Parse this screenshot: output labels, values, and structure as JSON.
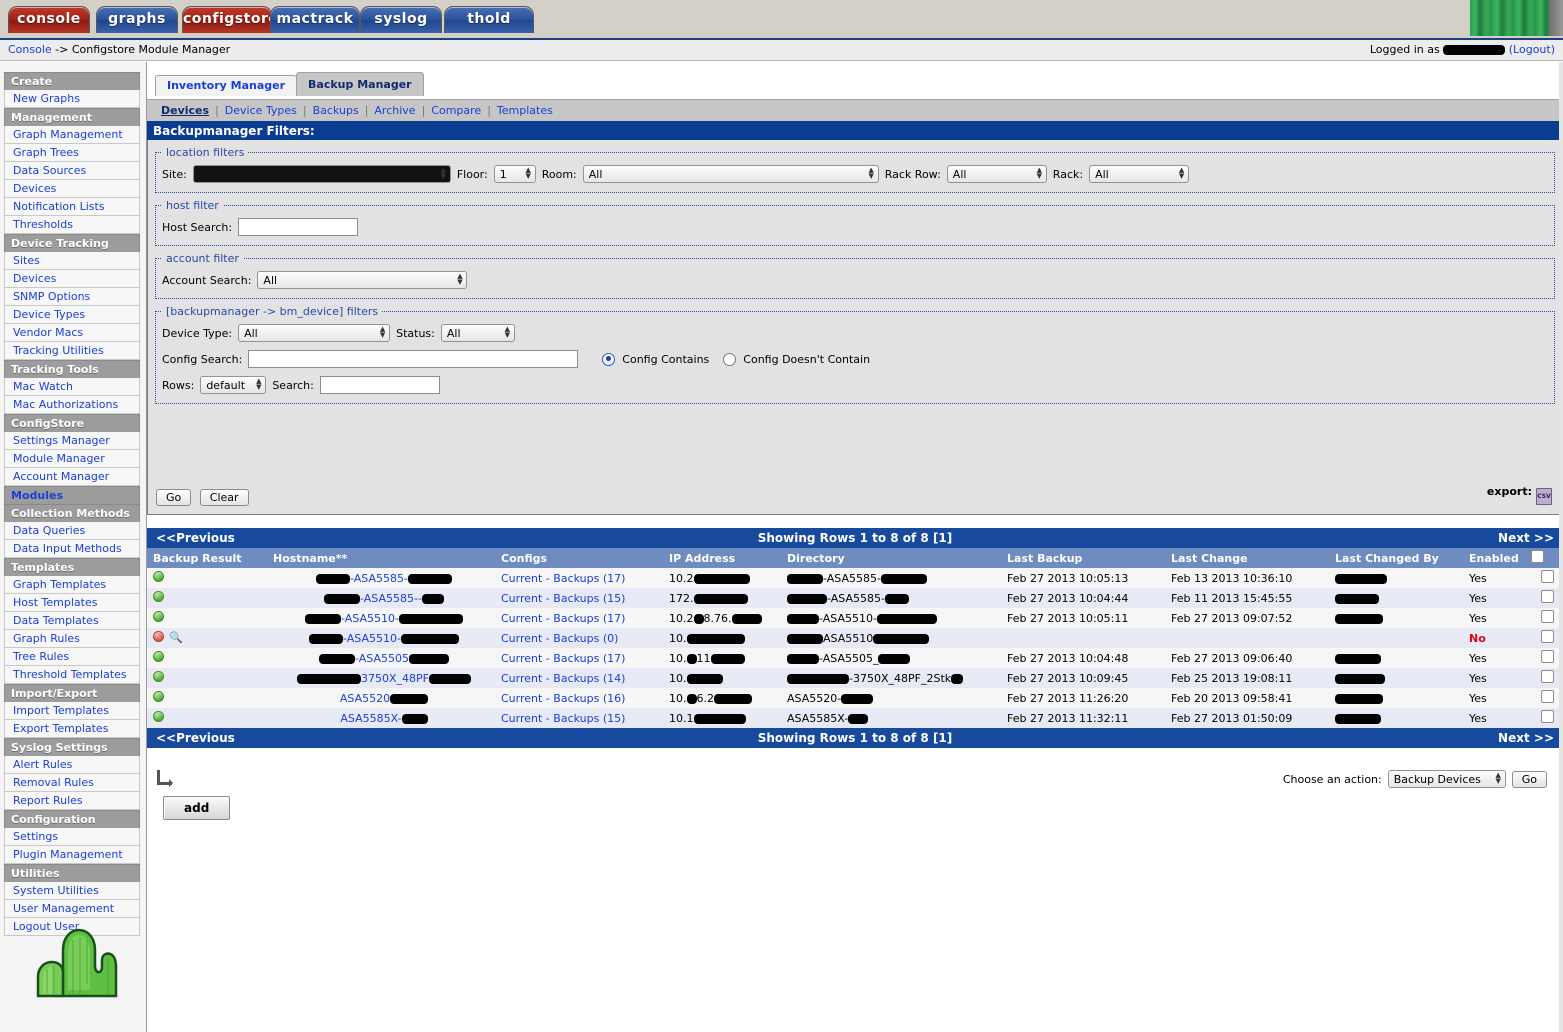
{
  "tabs": [
    {
      "label": "console",
      "color": "red"
    },
    {
      "label": "graphs",
      "color": "blue"
    },
    {
      "label": "configstore",
      "color": "red"
    },
    {
      "label": "mactrack",
      "color": "blue"
    },
    {
      "label": "syslog",
      "color": "blue"
    },
    {
      "label": "thold",
      "color": "blue"
    }
  ],
  "breadcrumb": {
    "root": "Console",
    "separator": " -> ",
    "current": "Configstore Module Manager"
  },
  "session": {
    "logged_in_prefix": "Logged in as",
    "user": "",
    "logout_label": "(Logout)"
  },
  "sidebar": {
    "groups": [
      {
        "title": "Create",
        "active": false,
        "items": [
          "New Graphs"
        ]
      },
      {
        "title": "Management",
        "active": false,
        "items": [
          "Graph Management",
          "Graph Trees",
          "Data Sources",
          "Devices",
          "Notification Lists",
          "Thresholds"
        ]
      },
      {
        "title": "Device Tracking",
        "active": false,
        "items": [
          "Sites",
          "Devices",
          "SNMP Options",
          "Device Types",
          "Vendor Macs",
          "Tracking Utilities"
        ]
      },
      {
        "title": "Tracking Tools",
        "active": false,
        "items": [
          "Mac Watch",
          "Mac Authorizations"
        ]
      },
      {
        "title": "ConfigStore",
        "active": false,
        "items": [
          "Settings Manager",
          "Module Manager",
          "Account Manager"
        ]
      },
      {
        "title": "Modules",
        "active": true,
        "items": []
      },
      {
        "title": "Collection Methods",
        "active": false,
        "items": [
          "Data Queries",
          "Data Input Methods"
        ]
      },
      {
        "title": "Templates",
        "active": false,
        "items": [
          "Graph Templates",
          "Host Templates",
          "Data Templates",
          "Graph Rules",
          "Tree Rules",
          "Threshold Templates"
        ]
      },
      {
        "title": "Import/Export",
        "active": false,
        "items": [
          "Import Templates",
          "Export Templates"
        ]
      },
      {
        "title": "Syslog Settings",
        "active": false,
        "items": [
          "Alert Rules",
          "Removal Rules",
          "Report Rules"
        ]
      },
      {
        "title": "Configuration",
        "active": false,
        "items": [
          "Settings",
          "Plugin Management"
        ]
      },
      {
        "title": "Utilities",
        "active": false,
        "items": [
          "System Utilities",
          "User Management",
          "Logout User"
        ]
      }
    ]
  },
  "subtabs": [
    {
      "label": "Inventory Manager",
      "selected": false
    },
    {
      "label": "Backup Manager",
      "selected": true
    }
  ],
  "actionbar": [
    {
      "label": "Devices",
      "current": true
    },
    {
      "label": "Device Types",
      "current": false
    },
    {
      "label": "Backups",
      "current": false
    },
    {
      "label": "Archive",
      "current": false
    },
    {
      "label": "Compare",
      "current": false
    },
    {
      "label": "Templates",
      "current": false
    }
  ],
  "filters": {
    "title": "Backupmanager Filters:",
    "location": {
      "legend": "location filters",
      "site_label": "Site:",
      "site_value": "",
      "floor_label": "Floor:",
      "floor_value": "1",
      "room_label": "Room:",
      "room_value": "All",
      "rackrow_label": "Rack Row:",
      "rackrow_value": "All",
      "rack_label": "Rack:",
      "rack_value": "All"
    },
    "host": {
      "legend": "host filter",
      "label": "Host Search:",
      "value": "",
      "placeholder": ""
    },
    "account": {
      "legend": "account filter",
      "label": "Account Search:",
      "value": "All"
    },
    "device": {
      "legend": "[backupmanager -> bm_device] filters",
      "device_type_label": "Device Type:",
      "device_type_value": "All",
      "status_label": "Status:",
      "status_value": "All",
      "config_search_label": "Config Search:",
      "config_search_value": "",
      "radio_contains": "Config Contains",
      "radio_not_contains": "Config Doesn't Contain",
      "radio_selected": "contains",
      "rows_label": "Rows:",
      "rows_value": "default",
      "search_label": "Search:",
      "search_value": ""
    },
    "go_label": "Go",
    "clear_label": "Clear",
    "export_label": "export:",
    "export_icon_text": "CSV"
  },
  "table": {
    "prev_label": "<<Previous",
    "next_label": "Next >>",
    "showing": "Showing Rows 1 to 8 of 8 [1]",
    "columns": [
      "Backup Result",
      "Hostname**",
      "Configs",
      "IP Address",
      "Directory",
      "Last Backup",
      "Last Change",
      "Last Changed By",
      "Enabled",
      ""
    ],
    "rows": [
      {
        "status": "green",
        "magnify": false,
        "hostname_prefix": "",
        "hostname_mid": "-ASA5585-",
        "hostname_suffix": "",
        "hostname_redact1": 34,
        "hostname_redact2": 44,
        "configs": "Current - Backups (17)",
        "ip_prefix": "10.2",
        "ip_redact": 56,
        "dir_prefix": "",
        "dir_mid": "-ASA5585-",
        "dir_redact1": 36,
        "dir_redact2": 46,
        "last_backup": "Feb 27 2013 10:05:13",
        "last_change": "Feb 13 2013 10:36:10",
        "changed_by_redact": 52,
        "enabled": "Yes"
      },
      {
        "status": "green",
        "magnify": false,
        "hostname_prefix": "",
        "hostname_mid": "-ASA5585--",
        "hostname_suffix": "",
        "hostname_redact1": 36,
        "hostname_redact2": 22,
        "configs": "Current - Backups (15)",
        "ip_prefix": "172.",
        "ip_redact": 54,
        "dir_prefix": "",
        "dir_mid": "-ASA5585-",
        "dir_redact1": 40,
        "dir_redact2": 24,
        "last_backup": "Feb 27 2013 10:04:44",
        "last_change": "Feb 11 2013 15:45:55",
        "changed_by_redact": 44,
        "enabled": "Yes"
      },
      {
        "status": "green",
        "magnify": false,
        "hostname_prefix": "",
        "hostname_mid": "-ASA5510-",
        "hostname_suffix": "",
        "hostname_redact1": 36,
        "hostname_redact2": 64,
        "configs": "Current - Backups (17)",
        "ip_prefix": "10.2",
        "ip_mid": "8.76.",
        "ip_redact": 30,
        "dir_prefix": "",
        "dir_mid": "-ASA5510-",
        "dir_redact1": 32,
        "dir_redact2": 60,
        "last_backup": "Feb 27 2013 10:05:11",
        "last_change": "Feb 27 2013 09:07:52",
        "changed_by_redact": 48,
        "enabled": "Yes"
      },
      {
        "status": "red",
        "magnify": true,
        "hostname_prefix": "",
        "hostname_mid": "-ASA5510-",
        "hostname_suffix": "",
        "hostname_redact1": 34,
        "hostname_redact2": 58,
        "configs": "Current - Backups (0)",
        "ip_prefix": "10.",
        "ip_redact": 58,
        "dir_prefix": "",
        "dir_mid": "ASA5510",
        "dir_redact1": 36,
        "dir_redact2": 56,
        "last_backup": "",
        "last_change": "",
        "changed_by_redact": 0,
        "enabled": "No"
      },
      {
        "status": "green",
        "magnify": false,
        "hostname_prefix": "",
        "hostname_mid": "-ASA5505",
        "hostname_suffix": "",
        "hostname_redact1": 36,
        "hostname_redact2": 40,
        "configs": "Current - Backups (17)",
        "ip_prefix": "10.",
        "ip_mid": "11",
        "ip_redact": 34,
        "dir_prefix": "",
        "dir_mid": "-ASA5505_",
        "dir_redact1": 32,
        "dir_redact2": 32,
        "last_backup": "Feb 27 2013 10:04:48",
        "last_change": "Feb 27 2013 09:06:40",
        "changed_by_redact": 46,
        "enabled": "Yes"
      },
      {
        "status": "green",
        "magnify": false,
        "hostname_prefix": "",
        "hostname_mid": "3750X_48PF",
        "hostname_suffix": "",
        "hostname_redact1": 64,
        "hostname_redact2": 42,
        "configs": "Current - Backups (14)",
        "ip_prefix": "10.",
        "ip_redact": 36,
        "dir_prefix": "",
        "dir_mid": "-3750X_48PF_2Stk",
        "dir_redact1": 62,
        "dir_redact2": 12,
        "last_backup": "Feb 27 2013 10:09:45",
        "last_change": "Feb 25 2013 19:08:11",
        "changed_by_redact": 50,
        "enabled": "Yes"
      },
      {
        "status": "green",
        "magnify": false,
        "hostname_prefix": "ASA5520",
        "hostname_mid": "",
        "hostname_suffix": "",
        "hostname_redact1": 0,
        "hostname_redact2": 38,
        "configs": "Current - Backups (16)",
        "ip_prefix": "10.",
        "ip_mid": "6.2",
        "ip_redact": 38,
        "dir_prefix": "ASA5520-",
        "dir_mid": "",
        "dir_redact1": 0,
        "dir_redact2": 32,
        "last_backup": "Feb 27 2013 11:26:20",
        "last_change": "Feb 20 2013 09:58:41",
        "changed_by_redact": 48,
        "enabled": "Yes"
      },
      {
        "status": "green",
        "magnify": false,
        "hostname_prefix": "ASA5585X-",
        "hostname_mid": "",
        "hostname_suffix": "",
        "hostname_redact1": 0,
        "hostname_redact2": 26,
        "configs": "Current - Backups (15)",
        "ip_prefix": "10.1",
        "ip_redact": 52,
        "dir_prefix": "ASA5585X-",
        "dir_mid": "",
        "dir_redact1": 0,
        "dir_redact2": 20,
        "last_backup": "Feb 27 2013 11:32:11",
        "last_change": "Feb 27 2013 01:50:09",
        "changed_by_redact": 46,
        "enabled": "Yes"
      }
    ]
  },
  "footer": {
    "add_label": "add",
    "choose_action_label": "Choose an action:",
    "action_value": "Backup Devices",
    "go_label": "Go"
  },
  "colors": {
    "header_blue": "#17499c",
    "subheader_blue": "#6f8cc0",
    "title_blue": "#0a3d91",
    "link": "#1a3fd4",
    "disabled_red": "#e4021b"
  }
}
